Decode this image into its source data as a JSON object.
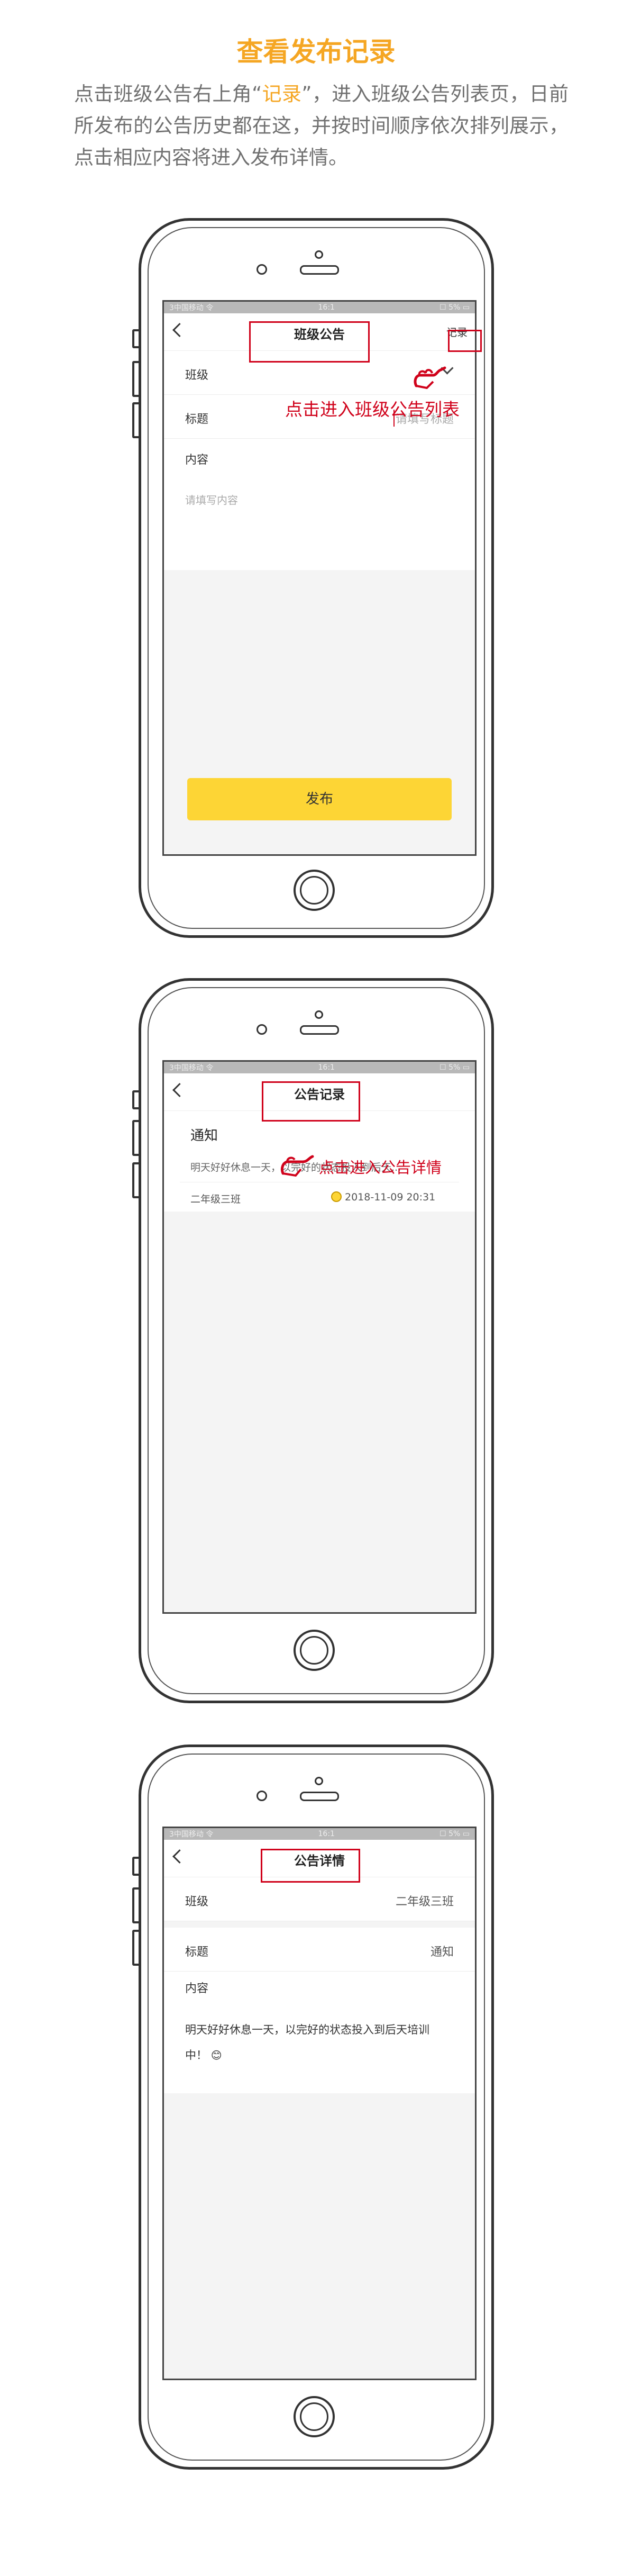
{
  "header": {
    "title": "查看发布记录",
    "desc_part1": "点击班级公告右上角“",
    "desc_highlight": "记录",
    "desc_part2": "”，进入班级公告列表页，日前所发布的公告历史都在这，并按时间顺序依次排列展示，点击相应内容将进入发布详情。"
  },
  "status_bar": {
    "carrier": "3中国移动 令",
    "time": "16:1",
    "battery": "☐ 5% ▭"
  },
  "screen1": {
    "title": "班级公告",
    "record_link": "记录",
    "class_label": "班级",
    "title_label": "标题",
    "title_placeholder": "请填写标题",
    "content_label": "内容",
    "content_placeholder": "请填写内容",
    "publish_button": "发布",
    "annotation": "点击进入班级公告列表"
  },
  "screen2": {
    "title": "公告记录",
    "item_title": "通知",
    "item_preview": "明天好好休息一天，以完好的状态投入到后天...",
    "item_class": "二年级三班",
    "item_time": "2018-11-09 20:31",
    "annotation": "点击进入公告详情"
  },
  "screen3": {
    "title": "公告详情",
    "class_label": "班级",
    "class_value": "二年级三班",
    "title_label": "标题",
    "title_value": "通知",
    "content_label": "内容",
    "content_text": "明天好好休息一天，以完好的状态投入到后天培训中！",
    "emoji": "😊"
  },
  "colors": {
    "accent": "#f5a623",
    "annotation_red": "#d0021b",
    "button_yellow": "#fdd535"
  }
}
